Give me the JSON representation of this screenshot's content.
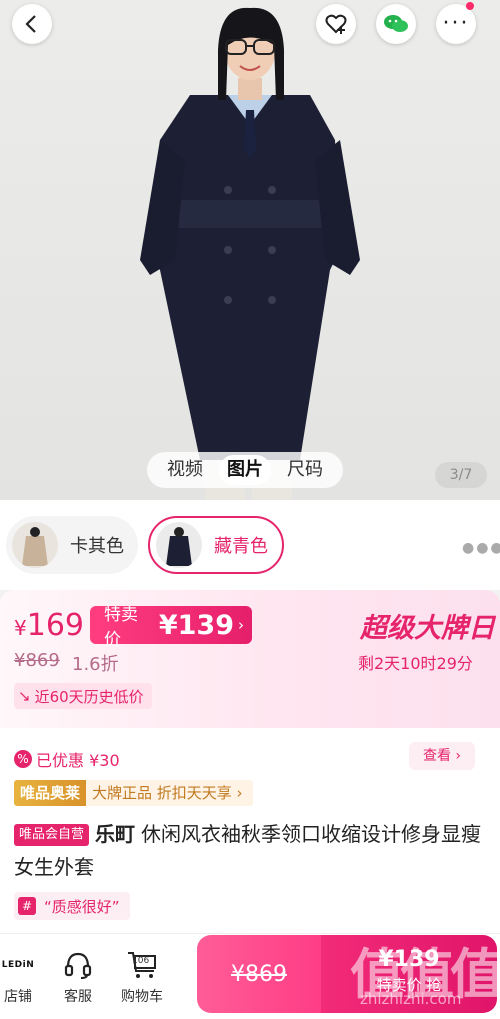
{
  "gallery": {
    "media_tabs": [
      "视频",
      "图片",
      "尺码"
    ],
    "active_tab": "图片",
    "counter": "3/7"
  },
  "colors": {
    "options": [
      {
        "label": "卡其色",
        "selected": false
      },
      {
        "label": "藏青色",
        "selected": true
      }
    ]
  },
  "price": {
    "currency": "¥",
    "current": "169",
    "flash_label": "特卖价",
    "flash_price": "¥139",
    "original": "¥869",
    "discount": "1.6折",
    "history_badge": "近60天历史低价",
    "event_title": "超级大牌日",
    "countdown": "剩2天10时29分",
    "accent_color": "#e6246b"
  },
  "promo": {
    "saved": "已优惠 ¥30",
    "check_label": "查看 ›",
    "outlet_tag": "唯品奥莱",
    "outlet_text": "大牌正品 折扣天天享 ›"
  },
  "product": {
    "self_tag": "唯品会自营",
    "brand": "乐町",
    "title": "休闲风衣袖秋季领口收缩设计修身显瘦女生外套",
    "review_tag": "“质感很好”"
  },
  "bottom_bar": {
    "store_logo": "LEDiN",
    "store_label": "店铺",
    "service_label": "客服",
    "cart_label": "购物车",
    "cart_count": "106",
    "buy_original": "¥869",
    "buy_price": "¥139",
    "buy_label": "特卖价 抢"
  },
  "watermark": {
    "text": "值值值",
    "url": "zhizhizhi.com"
  }
}
